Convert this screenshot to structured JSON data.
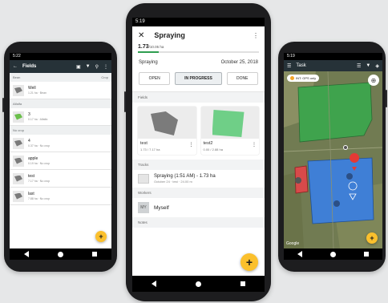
{
  "left": {
    "time": "5:22",
    "header_title": "Fields",
    "icons": [
      "map-icon",
      "filter-icon",
      "search-icon",
      "kebab-icon"
    ],
    "groups": [
      {
        "name": "Bean",
        "right": "Crop",
        "items": [
          {
            "name": "Well",
            "sub": "1.21 ha · Bean",
            "color": "gray"
          }
        ]
      },
      {
        "name": "Alfalfa",
        "right": "",
        "items": [
          {
            "name": "3",
            "sub": "0.17 ha · Alfalfa",
            "color": "green"
          }
        ]
      },
      {
        "name": "No crop",
        "right": "",
        "items": [
          {
            "name": "4",
            "sub": "0.37 ha · No crop",
            "color": "gray"
          },
          {
            "name": "apple",
            "sub": "0.19 ha · No crop",
            "color": "gray"
          },
          {
            "name": "test",
            "sub": "7.17 ha · No crop",
            "color": "gray"
          },
          {
            "name": "last",
            "sub": "7.88 ha · No crop",
            "color": "gray"
          }
        ]
      }
    ],
    "fab": "+"
  },
  "middle": {
    "time": "5:19",
    "title": "Spraying",
    "area_value": "1.73",
    "area_total": "/10.05 ha",
    "progress_fraction": 0.17,
    "activity": "Spraying",
    "date": "October 25, 2018",
    "status_buttons": [
      {
        "label": "OPEN",
        "active": false
      },
      {
        "label": "IN PROGRESS",
        "active": true
      },
      {
        "label": "DONE",
        "active": false
      }
    ],
    "fields_label": "Fields",
    "cards": [
      {
        "name": "test",
        "area": "1.73 / 7.17 ha"
      },
      {
        "name": "test2",
        "area": "0.00 / 2.88 ha"
      }
    ],
    "tracks_label": "Tracks",
    "track_title": "Spraying (1:51 AM) - 1.73 ha",
    "track_sub": "October 24 · test · 24.00 m",
    "workers_label": "Workers",
    "worker_initials": "MY",
    "worker_name": "Myself",
    "notes_label": "Notes",
    "fab": "+",
    "colors": {
      "accent": "#2e9e4f",
      "fab": "#fbc02d"
    }
  },
  "right": {
    "time": "5:19",
    "header_title": "Task",
    "gps_chip": "INT: GPS only",
    "map_attribution": "Google",
    "fab": "+",
    "colors": {
      "field_green": "#3fa34d",
      "field_blue": "#3f7fd6",
      "field_red": "#d84a4a"
    }
  }
}
